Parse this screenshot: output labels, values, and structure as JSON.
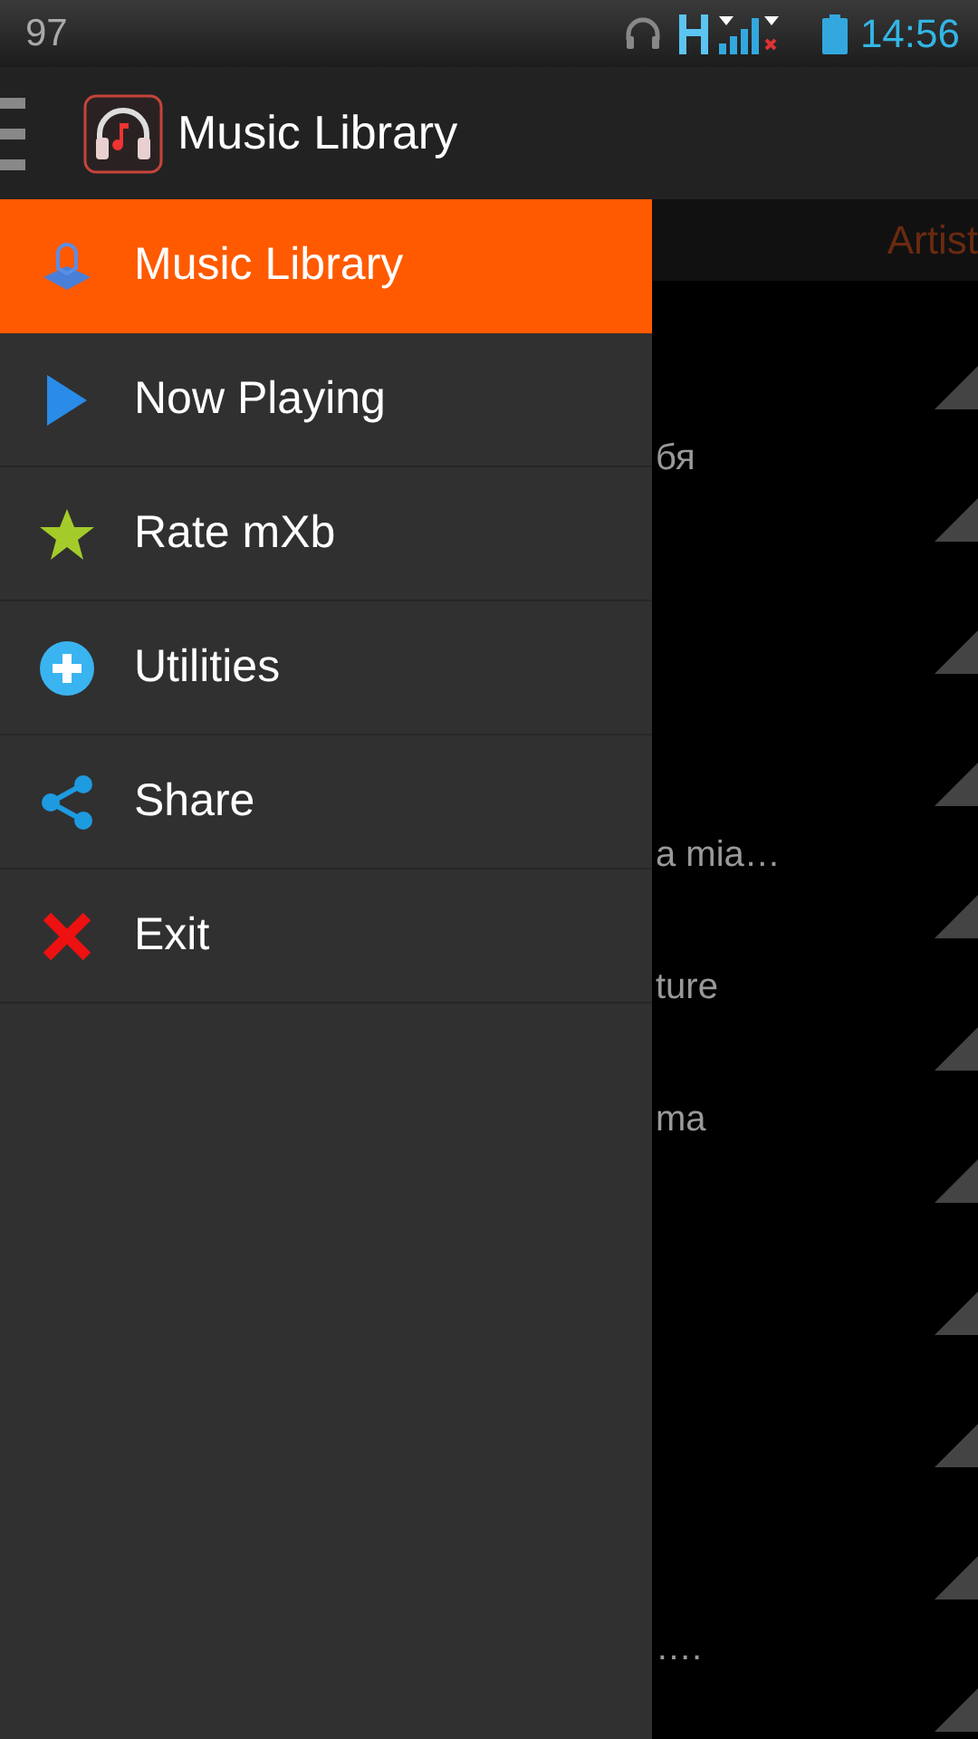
{
  "status_bar": {
    "left_text": "97",
    "time": "14:56"
  },
  "action_bar": {
    "title": "Music Library"
  },
  "list_header": {
    "label": "Artist"
  },
  "drawer": {
    "items": [
      {
        "label": "Music Library",
        "selected": true
      },
      {
        "label": "Now Playing",
        "selected": false
      },
      {
        "label": "Rate mXb",
        "selected": false
      },
      {
        "label": "Utilities",
        "selected": false
      },
      {
        "label": "Share",
        "selected": false
      },
      {
        "label": "Exit",
        "selected": false
      }
    ]
  },
  "list": {
    "rows": [
      {},
      {
        "text": "бя"
      },
      {},
      {},
      {
        "text": "a mia…"
      },
      {
        "text": "ture"
      },
      {
        "text": "ma"
      },
      {},
      {},
      {},
      {
        "text": "…."
      }
    ]
  }
}
